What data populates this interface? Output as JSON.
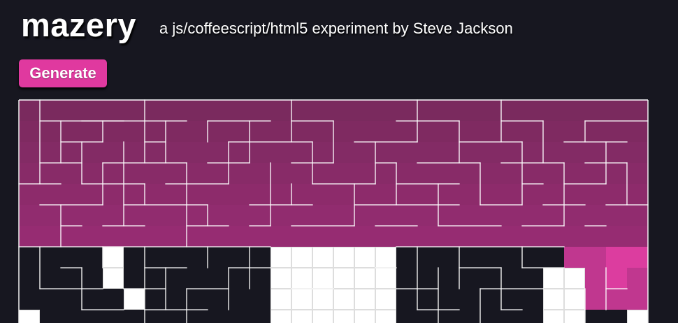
{
  "header": {
    "logo_text": "mazery",
    "tagline": "a js/coffeescript/html5 experiment by Steve Jackson"
  },
  "controls": {
    "generate_label": "Generate"
  },
  "maze": {
    "columns": 30,
    "visible_rows": 11,
    "colors": {
      "background": "#171720",
      "visited_top": "#7a2a5e",
      "visited_bottom": "#962c72",
      "active_path": "#c0378f",
      "current_cell": "#dc3d9f",
      "cleared_cell": "#ffffff",
      "wall": "#ffffff",
      "grid_on_light": "#dddddd"
    },
    "visited_full_rows": 7,
    "active_cells": [
      [
        7,
        26
      ],
      [
        7,
        27
      ],
      [
        7,
        28
      ],
      [
        7,
        29
      ],
      [
        8,
        27
      ],
      [
        8,
        28
      ],
      [
        8,
        29
      ],
      [
        9,
        27
      ],
      [
        9,
        28
      ],
      [
        9,
        29
      ]
    ],
    "current_cells": [
      [
        7,
        28
      ],
      [
        7,
        29
      ],
      [
        8,
        28
      ]
    ],
    "white_cells": [
      [
        7,
        4
      ],
      [
        8,
        4
      ],
      [
        9,
        5
      ],
      [
        7,
        12
      ],
      [
        7,
        13
      ],
      [
        7,
        14
      ],
      [
        7,
        15
      ],
      [
        7,
        16
      ],
      [
        7,
        17
      ],
      [
        8,
        12
      ],
      [
        8,
        13
      ],
      [
        8,
        14
      ],
      [
        8,
        15
      ],
      [
        8,
        16
      ],
      [
        8,
        17
      ],
      [
        9,
        12
      ],
      [
        9,
        13
      ],
      [
        9,
        14
      ],
      [
        9,
        15
      ],
      [
        9,
        16
      ],
      [
        9,
        17
      ],
      [
        10,
        12
      ],
      [
        10,
        13
      ],
      [
        10,
        14
      ],
      [
        10,
        15
      ],
      [
        10,
        16
      ],
      [
        10,
        17
      ],
      [
        8,
        25
      ],
      [
        8,
        26
      ],
      [
        9,
        25
      ],
      [
        9,
        26
      ],
      [
        10,
        25
      ],
      [
        10,
        26
      ],
      [
        9,
        29
      ],
      [
        10,
        29
      ],
      [
        10,
        0
      ]
    ],
    "walls": {
      "horizontal": [
        [
          1,
          1,
          8
        ],
        [
          1,
          3,
          5
        ],
        [
          1,
          9,
          12
        ],
        [
          1,
          13,
          15
        ],
        [
          1,
          18,
          21
        ],
        [
          1,
          23,
          25
        ],
        [
          1,
          27,
          30
        ],
        [
          2,
          2,
          4
        ],
        [
          2,
          6,
          7
        ],
        [
          2,
          10,
          14
        ],
        [
          2,
          16,
          19
        ],
        [
          2,
          21,
          24
        ],
        [
          2,
          26,
          29
        ],
        [
          3,
          1,
          3
        ],
        [
          3,
          4,
          8
        ],
        [
          3,
          9,
          11
        ],
        [
          3,
          13,
          15
        ],
        [
          3,
          17,
          18
        ],
        [
          3,
          19,
          22
        ],
        [
          3,
          23,
          26
        ],
        [
          3,
          27,
          29
        ],
        [
          4,
          0,
          2
        ],
        [
          4,
          3,
          6
        ],
        [
          4,
          7,
          10
        ],
        [
          4,
          14,
          17
        ],
        [
          4,
          18,
          21
        ],
        [
          4,
          24,
          25
        ],
        [
          4,
          26,
          28
        ],
        [
          5,
          1,
          4
        ],
        [
          5,
          5,
          9
        ],
        [
          5,
          11,
          14
        ],
        [
          5,
          16,
          21
        ],
        [
          5,
          22,
          24
        ],
        [
          5,
          25,
          27
        ],
        [
          5,
          28,
          30
        ],
        [
          6,
          2,
          3
        ],
        [
          6,
          4,
          6
        ],
        [
          6,
          8,
          10
        ],
        [
          6,
          11,
          12
        ],
        [
          6,
          13,
          16
        ],
        [
          6,
          17,
          19
        ],
        [
          6,
          20,
          23
        ],
        [
          6,
          24,
          26
        ],
        [
          6,
          27,
          28
        ],
        [
          7,
          0,
          12
        ],
        [
          7,
          18,
          26
        ],
        [
          8,
          2,
          3
        ],
        [
          8,
          6,
          8
        ],
        [
          8,
          10,
          12
        ],
        [
          8,
          17,
          18
        ],
        [
          8,
          21,
          23
        ],
        [
          8,
          24,
          26
        ],
        [
          9,
          1,
          4
        ],
        [
          9,
          5,
          7
        ],
        [
          9,
          8,
          10
        ],
        [
          9,
          13,
          15
        ],
        [
          9,
          18,
          20
        ],
        [
          9,
          22,
          25
        ],
        [
          9,
          28,
          29
        ],
        [
          10,
          3,
          5
        ],
        [
          10,
          6,
          9
        ],
        [
          10,
          19,
          21
        ],
        [
          10,
          23,
          24
        ]
      ],
      "vertical": [
        [
          1,
          0,
          4
        ],
        [
          2,
          1,
          3
        ],
        [
          2,
          5,
          7
        ],
        [
          3,
          2,
          4
        ],
        [
          4,
          1,
          2
        ],
        [
          4,
          3,
          5
        ],
        [
          5,
          2,
          6
        ],
        [
          6,
          0,
          3
        ],
        [
          6,
          4,
          5
        ],
        [
          7,
          1,
          3
        ],
        [
          8,
          3,
          7
        ],
        [
          9,
          1,
          2
        ],
        [
          9,
          5,
          6
        ],
        [
          10,
          2,
          4
        ],
        [
          11,
          1,
          3
        ],
        [
          12,
          3,
          6
        ],
        [
          13,
          0,
          2
        ],
        [
          13,
          4,
          5
        ],
        [
          14,
          2,
          4
        ],
        [
          15,
          1,
          3
        ],
        [
          16,
          4,
          6
        ],
        [
          17,
          2,
          4
        ],
        [
          18,
          3,
          5
        ],
        [
          19,
          0,
          2
        ],
        [
          20,
          4,
          6
        ],
        [
          21,
          1,
          3
        ],
        [
          22,
          3,
          5
        ],
        [
          23,
          0,
          2
        ],
        [
          24,
          2,
          5
        ],
        [
          25,
          1,
          3
        ],
        [
          26,
          3,
          6
        ],
        [
          27,
          1,
          2
        ],
        [
          28,
          2,
          4
        ],
        [
          29,
          3,
          5
        ],
        [
          1,
          7,
          9
        ],
        [
          3,
          8,
          10
        ],
        [
          4,
          7,
          8
        ],
        [
          6,
          7,
          11
        ],
        [
          7,
          8,
          10
        ],
        [
          8,
          9,
          11
        ],
        [
          9,
          7,
          8
        ],
        [
          10,
          8,
          10
        ],
        [
          11,
          7,
          9
        ],
        [
          19,
          7,
          10
        ],
        [
          20,
          8,
          11
        ],
        [
          21,
          7,
          9
        ],
        [
          22,
          9,
          11
        ],
        [
          23,
          8,
          10
        ],
        [
          24,
          7,
          8
        ],
        [
          27,
          9,
          11
        ],
        [
          28,
          8,
          10
        ]
      ]
    }
  }
}
